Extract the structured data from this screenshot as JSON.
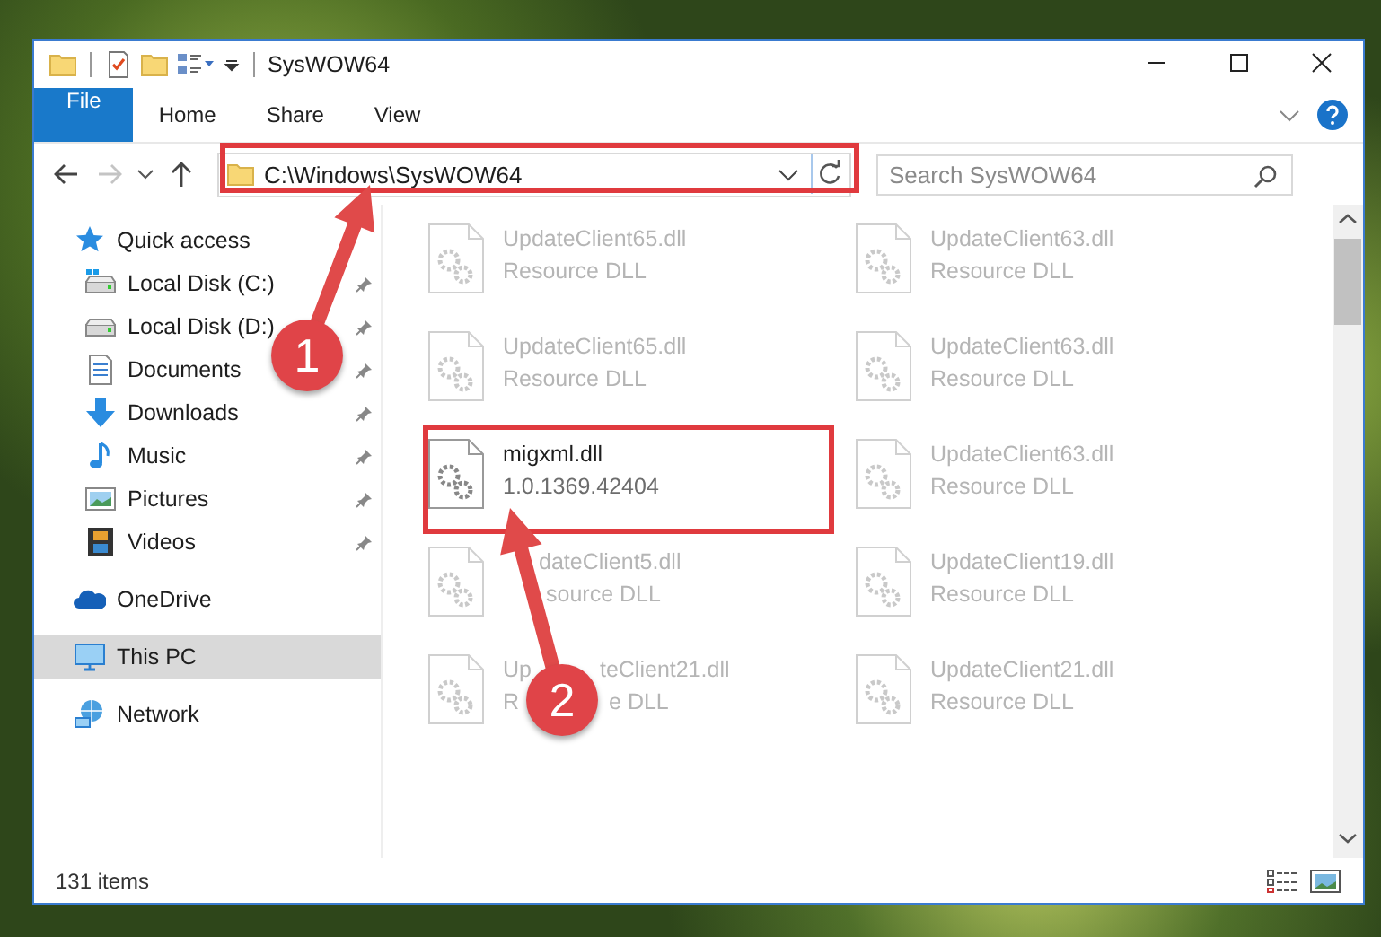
{
  "window": {
    "title": "SysWOW64"
  },
  "ribbon": {
    "tabs": [
      {
        "label": "File",
        "kind": "file",
        "selected": false
      },
      {
        "label": "Home",
        "kind": "tab",
        "selected": false
      },
      {
        "label": "Share",
        "kind": "tab",
        "selected": false
      },
      {
        "label": "View",
        "kind": "tab",
        "selected": false
      }
    ]
  },
  "address_bar": {
    "path": "C:\\Windows\\SysWOW64"
  },
  "search": {
    "placeholder": "Search SysWOW64"
  },
  "sidebar": {
    "items": [
      {
        "label": "Quick access",
        "kind": "quick-access",
        "selected": false,
        "children": [
          {
            "label": "Local Disk (C:)",
            "kind": "system-drive",
            "selected": false,
            "pinned": true
          },
          {
            "label": "Local Disk (D:)",
            "kind": "drive",
            "selected": false,
            "pinned": true
          },
          {
            "label": "Documents",
            "kind": "documents",
            "selected": false,
            "pinned": true
          },
          {
            "label": "Downloads",
            "kind": "downloads",
            "selected": false,
            "pinned": true
          },
          {
            "label": "Music",
            "kind": "music",
            "selected": false,
            "pinned": true
          },
          {
            "label": "Pictures",
            "kind": "pictures",
            "selected": false,
            "pinned": true
          },
          {
            "label": "Videos",
            "kind": "videos",
            "selected": false,
            "pinned": true
          }
        ]
      },
      {
        "label": "OneDrive",
        "kind": "onedrive",
        "selected": false
      },
      {
        "label": "This PC",
        "kind": "pc",
        "selected": true
      },
      {
        "label": "Network",
        "kind": "network",
        "selected": false
      }
    ]
  },
  "files": [
    {
      "name": "UpdateClient65.dll",
      "detail": "Resource DLL",
      "blurred": true
    },
    {
      "name": "UpdateClient63.dll",
      "detail": "Resource DLL",
      "blurred": true
    },
    {
      "name": "UpdateClient65.dll",
      "detail": "Resource DLL",
      "blurred": true
    },
    {
      "name": "UpdateClient63.dll",
      "detail": "Resource DLL",
      "blurred": true
    },
    {
      "name": "migxml.dll",
      "detail": "1.0.1369.42404",
      "blurred": false
    },
    {
      "name": "UpdateClient63.dll",
      "detail": "Resource DLL",
      "blurred": true
    },
    {
      "name": [
        "dateClient5.dll"
      ],
      "detail": [
        "source DLL"
      ],
      "blurred": true
    },
    {
      "name": "UpdateClient19.dll",
      "detail": "Resource DLL",
      "blurred": true
    },
    {
      "name": [
        "Up",
        "teClient21.dll"
      ],
      "detail": [
        "R",
        "e DLL"
      ],
      "blurred": true
    },
    {
      "name": "UpdateClient21.dll",
      "detail": "Resource DLL",
      "blurred": true
    }
  ],
  "status_bar": {
    "item_count": "131 items"
  },
  "annotations": [
    {
      "number": "1"
    },
    {
      "number": "2"
    }
  ]
}
